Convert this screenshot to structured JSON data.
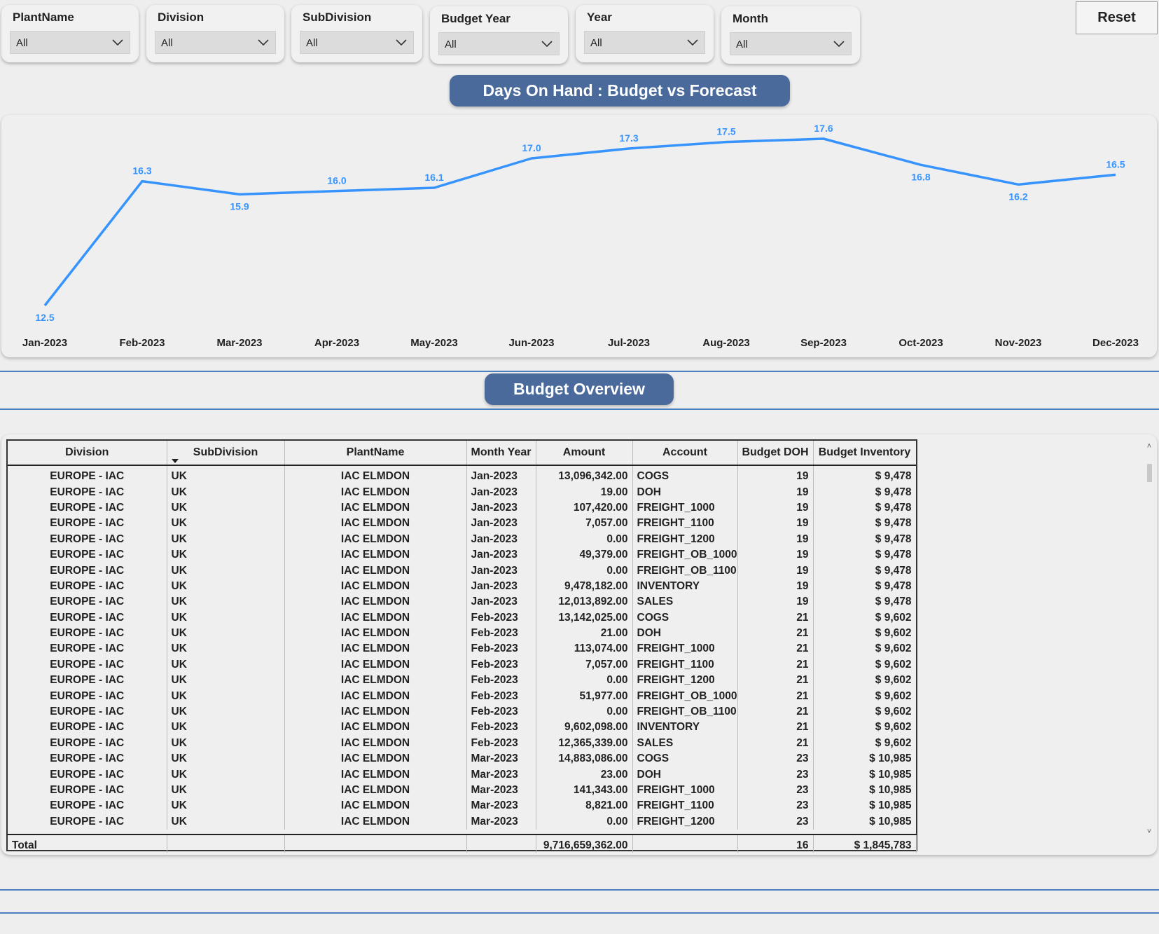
{
  "filters": [
    {
      "label": "PlantName",
      "value": "All"
    },
    {
      "label": "Division",
      "value": "All"
    },
    {
      "label": "SubDivision",
      "value": "All"
    },
    {
      "label": "Budget Year",
      "value": "All"
    },
    {
      "label": "Year",
      "value": "All"
    },
    {
      "label": "Month",
      "value": "All"
    }
  ],
  "reset_label": "Reset",
  "chart_title": "Days On Hand : Budget vs Forecast",
  "overview_title": "Budget Overview",
  "colors": {
    "accent": "#4a6a9c",
    "line": "#3794ff",
    "divider": "#4a7fc1"
  },
  "chart_data": {
    "type": "line",
    "title": "Days On Hand : Budget vs Forecast",
    "categories": [
      "Jan-2023",
      "Feb-2023",
      "Mar-2023",
      "Apr-2023",
      "May-2023",
      "Jun-2023",
      "Jul-2023",
      "Aug-2023",
      "Sep-2023",
      "Oct-2023",
      "Nov-2023",
      "Dec-2023"
    ],
    "values": [
      12.5,
      16.3,
      15.9,
      16.0,
      16.1,
      17.0,
      17.3,
      17.5,
      17.6,
      16.8,
      16.2,
      16.5
    ],
    "ylim": [
      12.5,
      17.6
    ],
    "grid": false,
    "legend": "none"
  },
  "table": {
    "columns": [
      "Division",
      "SubDivision",
      "PlantName",
      "Month Year",
      "Amount",
      "Account",
      "Budget DOH",
      "Budget Inventory"
    ],
    "rows": [
      [
        "EUROPE - IAC",
        "UK",
        "IAC ELMDON",
        "Jan-2023",
        "13,096,342.00",
        "COGS",
        "19",
        "$ 9,478"
      ],
      [
        "EUROPE - IAC",
        "UK",
        "IAC ELMDON",
        "Jan-2023",
        "19.00",
        "DOH",
        "19",
        "$ 9,478"
      ],
      [
        "EUROPE - IAC",
        "UK",
        "IAC ELMDON",
        "Jan-2023",
        "107,420.00",
        "FREIGHT_1000",
        "19",
        "$ 9,478"
      ],
      [
        "EUROPE - IAC",
        "UK",
        "IAC ELMDON",
        "Jan-2023",
        "7,057.00",
        "FREIGHT_1100",
        "19",
        "$ 9,478"
      ],
      [
        "EUROPE - IAC",
        "UK",
        "IAC ELMDON",
        "Jan-2023",
        "0.00",
        "FREIGHT_1200",
        "19",
        "$ 9,478"
      ],
      [
        "EUROPE - IAC",
        "UK",
        "IAC ELMDON",
        "Jan-2023",
        "49,379.00",
        "FREIGHT_OB_1000",
        "19",
        "$ 9,478"
      ],
      [
        "EUROPE - IAC",
        "UK",
        "IAC ELMDON",
        "Jan-2023",
        "0.00",
        "FREIGHT_OB_1100",
        "19",
        "$ 9,478"
      ],
      [
        "EUROPE - IAC",
        "UK",
        "IAC ELMDON",
        "Jan-2023",
        "9,478,182.00",
        "INVENTORY",
        "19",
        "$ 9,478"
      ],
      [
        "EUROPE - IAC",
        "UK",
        "IAC ELMDON",
        "Jan-2023",
        "12,013,892.00",
        "SALES",
        "19",
        "$ 9,478"
      ],
      [
        "EUROPE - IAC",
        "UK",
        "IAC ELMDON",
        "Feb-2023",
        "13,142,025.00",
        "COGS",
        "21",
        "$ 9,602"
      ],
      [
        "EUROPE - IAC",
        "UK",
        "IAC ELMDON",
        "Feb-2023",
        "21.00",
        "DOH",
        "21",
        "$ 9,602"
      ],
      [
        "EUROPE - IAC",
        "UK",
        "IAC ELMDON",
        "Feb-2023",
        "113,074.00",
        "FREIGHT_1000",
        "21",
        "$ 9,602"
      ],
      [
        "EUROPE - IAC",
        "UK",
        "IAC ELMDON",
        "Feb-2023",
        "7,057.00",
        "FREIGHT_1100",
        "21",
        "$ 9,602"
      ],
      [
        "EUROPE - IAC",
        "UK",
        "IAC ELMDON",
        "Feb-2023",
        "0.00",
        "FREIGHT_1200",
        "21",
        "$ 9,602"
      ],
      [
        "EUROPE - IAC",
        "UK",
        "IAC ELMDON",
        "Feb-2023",
        "51,977.00",
        "FREIGHT_OB_1000",
        "21",
        "$ 9,602"
      ],
      [
        "EUROPE - IAC",
        "UK",
        "IAC ELMDON",
        "Feb-2023",
        "0.00",
        "FREIGHT_OB_1100",
        "21",
        "$ 9,602"
      ],
      [
        "EUROPE - IAC",
        "UK",
        "IAC ELMDON",
        "Feb-2023",
        "9,602,098.00",
        "INVENTORY",
        "21",
        "$ 9,602"
      ],
      [
        "EUROPE - IAC",
        "UK",
        "IAC ELMDON",
        "Feb-2023",
        "12,365,339.00",
        "SALES",
        "21",
        "$ 9,602"
      ],
      [
        "EUROPE - IAC",
        "UK",
        "IAC ELMDON",
        "Mar-2023",
        "14,883,086.00",
        "COGS",
        "23",
        "$ 10,985"
      ],
      [
        "EUROPE - IAC",
        "UK",
        "IAC ELMDON",
        "Mar-2023",
        "23.00",
        "DOH",
        "23",
        "$ 10,985"
      ],
      [
        "EUROPE - IAC",
        "UK",
        "IAC ELMDON",
        "Mar-2023",
        "141,343.00",
        "FREIGHT_1000",
        "23",
        "$ 10,985"
      ],
      [
        "EUROPE - IAC",
        "UK",
        "IAC ELMDON",
        "Mar-2023",
        "8,821.00",
        "FREIGHT_1100",
        "23",
        "$ 10,985"
      ],
      [
        "EUROPE - IAC",
        "UK",
        "IAC ELMDON",
        "Mar-2023",
        "0.00",
        "FREIGHT_1200",
        "23",
        "$ 10,985"
      ]
    ],
    "total": {
      "label": "Total",
      "amount": "9,716,659,362.00",
      "doh": "16",
      "inventory": "$ 1,845,783"
    }
  }
}
